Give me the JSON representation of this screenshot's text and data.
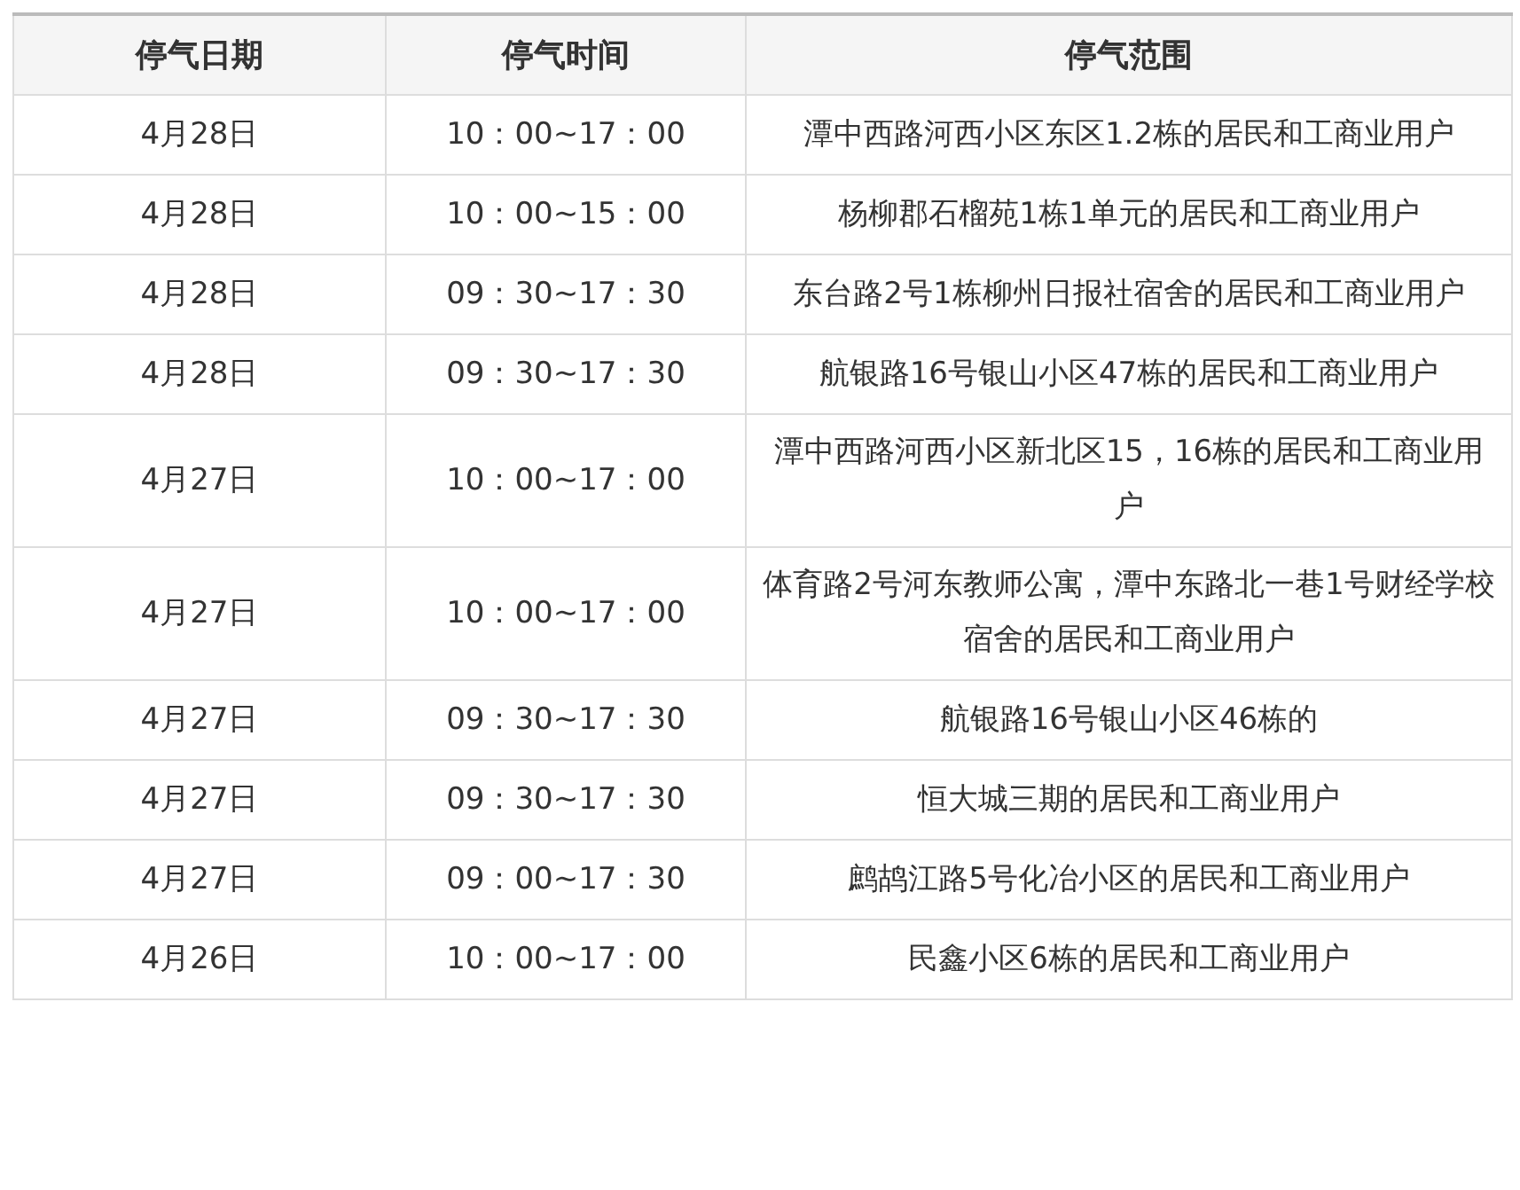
{
  "table": {
    "columns": [
      "停气日期",
      "停气时间",
      "停气范围"
    ],
    "rows": [
      {
        "date": "4月28日",
        "time": "10：00~17：00",
        "area": "潭中西路河西小区东区1.2栋的居民和工商业用户"
      },
      {
        "date": "4月28日",
        "time": "10：00~15：00",
        "area": "杨柳郡石榴苑1栋1单元的居民和工商业用户"
      },
      {
        "date": "4月28日",
        "time": "09：30~17：30",
        "area": "东台路2号1栋柳州日报社宿舍的居民和工商业用户"
      },
      {
        "date": "4月28日",
        "time": "09：30~17：30",
        "area": "航银路16号银山小区47栋的居民和工商业用户"
      },
      {
        "date": "4月27日",
        "time": "10：00~17：00",
        "area": "潭中西路河西小区新北区15，16栋的居民和工商业用户"
      },
      {
        "date": "4月27日",
        "time": "10：00~17：00",
        "area": "体育路2号河东教师公寓，潭中东路北一巷1号财经学校宿舍的居民和工商业用户"
      },
      {
        "date": "4月27日",
        "time": "09：30~17：30",
        "area": "航银路16号银山小区46栋的"
      },
      {
        "date": "4月27日",
        "time": "09：30~17：30",
        "area": "恒大城三期的居民和工商业用户"
      },
      {
        "date": "4月27日",
        "time": "09：00~17：30",
        "area": "鹧鸪江路5号化冶小区的居民和工商业用户"
      },
      {
        "date": "4月26日",
        "time": "10：00~17：00",
        "area": "民鑫小区6栋的居民和工商业用户"
      }
    ]
  }
}
